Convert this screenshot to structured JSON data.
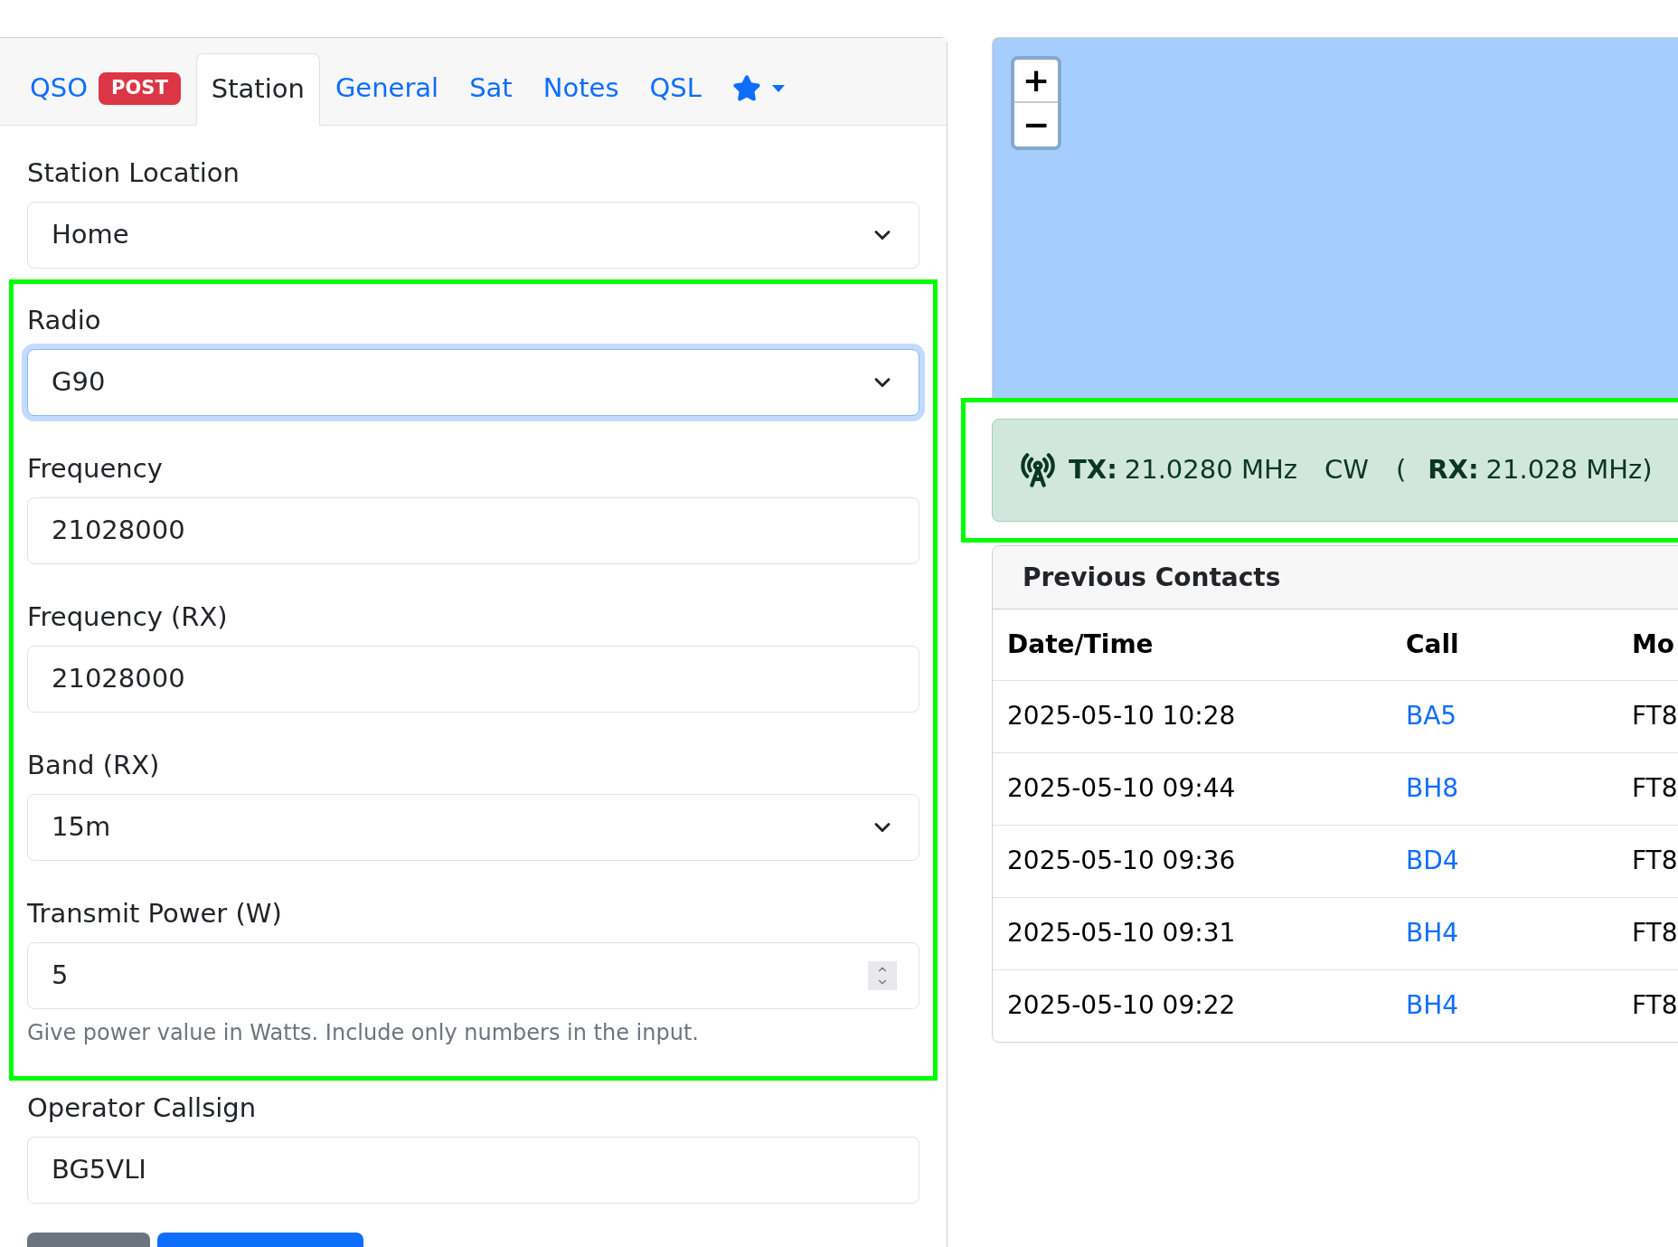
{
  "tabs": [
    {
      "kind": "text",
      "label": "QSO",
      "badge": "POST",
      "selected": false
    },
    {
      "kind": "text",
      "label": "Station",
      "selected": true
    },
    {
      "kind": "text",
      "label": "General",
      "selected": false
    },
    {
      "kind": "text",
      "label": "Sat",
      "selected": false
    },
    {
      "kind": "text",
      "label": "Notes",
      "selected": false
    },
    {
      "kind": "text",
      "label": "QSL",
      "selected": false
    },
    {
      "kind": "favorites",
      "selected": false
    }
  ],
  "form": {
    "sections": [
      {
        "highlighted": false,
        "fields": [
          {
            "kind": "select",
            "label": "Station Location",
            "value": "Home",
            "focused": false
          }
        ]
      },
      {
        "highlighted": true,
        "fields": [
          {
            "kind": "select",
            "label": "Radio",
            "value": "G90",
            "focused": true
          },
          {
            "kind": "input",
            "label": "Frequency",
            "value": "21028000",
            "focused": false
          },
          {
            "kind": "input",
            "label": "Frequency (RX)",
            "value": "21028000",
            "focused": false
          },
          {
            "kind": "select",
            "label": "Band (RX)",
            "value": "15m",
            "focused": false
          },
          {
            "kind": "number",
            "label": "Transmit Power (W)",
            "value": "5",
            "focused": false,
            "help": "Give power value in Watts. Include only numbers in the input."
          }
        ]
      },
      {
        "highlighted": false,
        "fields": [
          {
            "kind": "input",
            "label": "Operator Callsign",
            "value": "BG5VLI",
            "focused": false
          }
        ]
      }
    ],
    "buttons": [
      {
        "kind": "secondary"
      },
      {
        "kind": "primary"
      }
    ]
  },
  "map": {
    "zoom_in": "+",
    "zoom_out": "−"
  },
  "radio_status": {
    "highlighted": true,
    "tx_label": "TX:",
    "tx": "21.0280 MHz",
    "mode": "CW",
    "open": "(",
    "rx_label": "RX:",
    "rx": "21.028 MHz)"
  },
  "previous_contacts": {
    "title": "Previous Contacts",
    "columns": [
      "Date/Time",
      "Call",
      "Mo"
    ],
    "rows": [
      [
        "2025-05-10 10:28",
        "BA5",
        "FT8"
      ],
      [
        "2025-05-10 09:44",
        "BH8",
        "FT8"
      ],
      [
        "2025-05-10 09:36",
        "BD4",
        "FT8"
      ],
      [
        "2025-05-10 09:31",
        "BH4",
        "FT8"
      ],
      [
        "2025-05-10 09:22",
        "BH4",
        "FT8"
      ]
    ]
  }
}
